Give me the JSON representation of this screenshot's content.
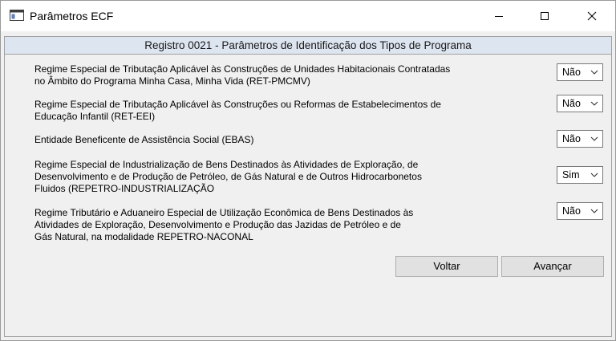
{
  "window": {
    "title": "Parâmetros ECF"
  },
  "panel": {
    "header": "Registro 0021 - Parâmetros de Identificação dos Tipos de Programa"
  },
  "questions": [
    {
      "lines": [
        "Regime Especial de Tributação Aplicável às Construções de Unidades Habitacionais Contratadas",
        "no Âmbito do Programa Minha Casa, Minha Vida (RET-PMCMV)"
      ],
      "value": "Não"
    },
    {
      "lines": [
        "Regime Especial de Tributação Aplicável às Construções ou Reformas de Estabelecimentos de",
        "Educação Infantil (RET-EEI)"
      ],
      "value": "Não"
    },
    {
      "lines": [
        "Entidade Beneficente de Assistência Social (EBAS)"
      ],
      "value": "Não"
    },
    {
      "lines": [
        "Regime Especial de Industrialização de Bens Destinados às Atividades de Exploração, de",
        "Desenvolvimento e de Produção de Petróleo, de Gás Natural e de Outros Hidrocarbonetos",
        "Fluidos (REPETRO-INDUSTRIALIZAÇÃO"
      ],
      "value": "Sim"
    },
    {
      "lines": [
        "Regime Tributário e Aduaneiro Especial de Utilização Econômica de Bens Destinados às",
        "Atividades de Exploração, Desenvolvimento e Produção das Jazidas de Petróleo e de",
        "Gás Natural, na modalidade REPETRO-NACONAL"
      ],
      "value": "Não"
    }
  ],
  "buttons": {
    "back": "Voltar",
    "next": "Avançar"
  },
  "icons": {
    "app": "window-app-icon",
    "minimize": "minimize-icon",
    "maximize": "maximize-icon",
    "close": "close-icon",
    "dropdown": "chevron-down-icon"
  }
}
